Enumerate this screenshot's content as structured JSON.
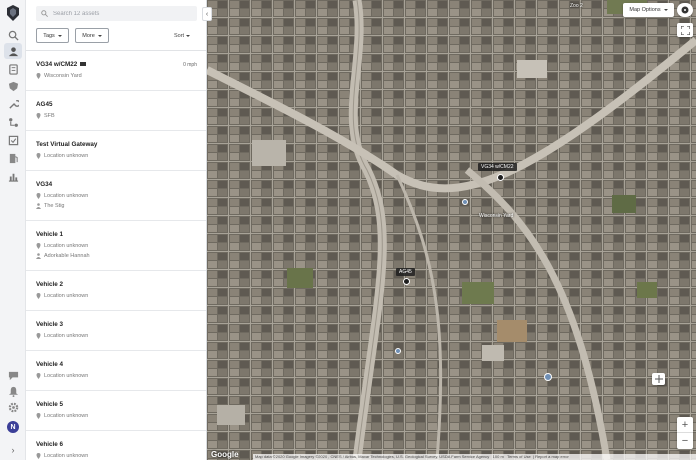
{
  "search": {
    "placeholder": "Search 12 assets"
  },
  "filters": {
    "tags_label": "Tags",
    "more_label": "More",
    "sort_label": "Sort"
  },
  "assets": [
    {
      "name": "VG34 w/CM22",
      "speed": "0 mph",
      "location": "Wisconsin Yard",
      "driver": ""
    },
    {
      "name": "AG45",
      "location": "SFB",
      "driver": ""
    },
    {
      "name": "Test Virtual Gateway",
      "location": "Location unknown",
      "driver": ""
    },
    {
      "name": "VG34",
      "location": "Location unknown",
      "driver": "The Stig"
    },
    {
      "name": "Vehicle 1",
      "location": "Location unknown",
      "driver": "Adorkable Hannah"
    },
    {
      "name": "Vehicle 2",
      "location": "Location unknown",
      "driver": ""
    },
    {
      "name": "Vehicle 3",
      "location": "Location unknown",
      "driver": ""
    },
    {
      "name": "Vehicle 4",
      "location": "Location unknown",
      "driver": ""
    },
    {
      "name": "Vehicle 5",
      "location": "Location unknown",
      "driver": ""
    },
    {
      "name": "Vehicle 6",
      "location": "Location unknown",
      "driver": ""
    }
  ],
  "user": {
    "initial": "N"
  },
  "map": {
    "options_label": "Map Options",
    "markers": [
      {
        "label": "VG34 w/CM22"
      },
      {
        "label": "AG45"
      }
    ],
    "places": [
      "Wisconsin Yard",
      "Zoo 2"
    ],
    "attribution": "Map data ©2020 Google Imagery ©2020 , CNES / Airbus, Maxar Technologies, U.S. Geological Survey, USDA Farm Service Agency",
    "scale": "100 m",
    "terms": "Terms of Use",
    "report": "Report a map error",
    "logo": "Google"
  },
  "colors": {
    "accent": "#3b3f98",
    "map_base": "#7a7469",
    "marker_label_bg": "#1e1e1e"
  }
}
